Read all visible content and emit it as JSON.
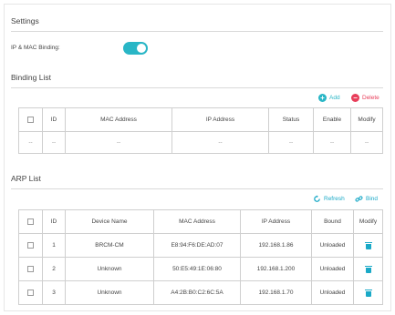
{
  "settings": {
    "title": "Settings",
    "binding_label": "IP & MAC Binding:",
    "binding_enabled": true
  },
  "binding_list": {
    "title": "Binding List",
    "add_label": "Add",
    "delete_label": "Delete",
    "columns": [
      "",
      "ID",
      "MAC Address",
      "IP Address",
      "Status",
      "Enable",
      "Modify"
    ],
    "rows": [
      [
        "",
        "--",
        "--",
        "--",
        "--",
        "--",
        "--"
      ]
    ]
  },
  "arp_list": {
    "title": "ARP List",
    "refresh_label": "Refresh",
    "bind_label": "Bind",
    "columns": [
      "",
      "ID",
      "Device Name",
      "MAC Address",
      "IP Address",
      "Bound",
      "Modify"
    ],
    "rows": [
      {
        "id": "1",
        "device_name": "BRCM-CM",
        "mac": "E8:94:F6:DE:AD:07",
        "ip": "192.168.1.86",
        "bound": "Unloaded"
      },
      {
        "id": "2",
        "device_name": "Unknown",
        "mac": "50:E5:49:1E:06:80",
        "ip": "192.168.1.200",
        "bound": "Unloaded"
      },
      {
        "id": "3",
        "device_name": "Unknown",
        "mac": "A4:2B:B0:C2:6C:5A",
        "ip": "192.168.1.70",
        "bound": "Unloaded"
      }
    ]
  },
  "icons": {
    "add": "plus-circle-icon",
    "delete": "minus-circle-icon",
    "refresh": "refresh-icon",
    "bind": "link-icon",
    "modify": "trash-icon"
  },
  "colors": {
    "accent": "#29b6c6",
    "delete": "#e83e5a",
    "link": "#1aa9c7"
  }
}
